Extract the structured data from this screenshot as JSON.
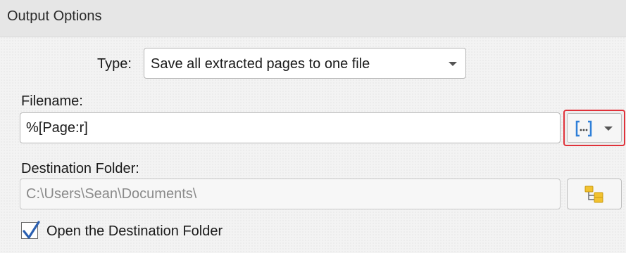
{
  "section": {
    "title": "Output Options"
  },
  "type_field": {
    "label": "Type:",
    "selected": "Save all extracted pages to one file"
  },
  "filename_field": {
    "label": "Filename:",
    "value": "%[Page:r]",
    "macro_button_icon": "macro-brackets-icon",
    "macro_dropdown_icon": "chevron-down-icon"
  },
  "destination_field": {
    "label": "Destination Folder:",
    "value": "C:\\Users\\Sean\\Documents\\",
    "browse_icon": "folder-tree-icon"
  },
  "open_folder": {
    "label": "Open the Destination Folder",
    "checked": true
  },
  "colors": {
    "accent_blue": "#2f7fd8",
    "highlight_red": "#e0323a",
    "folder_yellow": "#f2c230"
  }
}
